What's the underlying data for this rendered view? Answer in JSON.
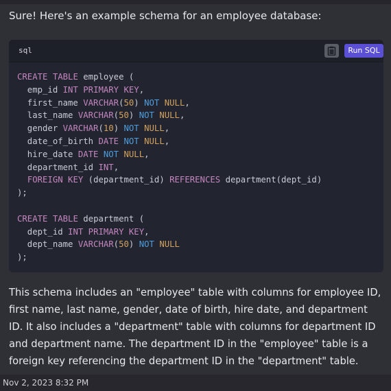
{
  "message": {
    "intro": "Sure! Here's an example schema for an employee database:",
    "explanation": "This schema includes an \"employee\" table with columns for employee ID, first name, last name, gender, date of birth, hire date, and department ID. It also includes a \"department\" table with columns for department ID and department name. The department ID in the \"employee\" table is a foreign key referencing the department ID in the \"department\" table.",
    "timestamp": "Nov 2, 2023 8:32 PM"
  },
  "code_block": {
    "language": "sql",
    "copy_icon": "clipboard-icon",
    "run_label": "Run SQL",
    "lines": [
      "CREATE TABLE employee (",
      "  emp_id INT PRIMARY KEY,",
      "  first_name VARCHAR(50) NOT NULL,",
      "  last_name VARCHAR(50) NOT NULL,",
      "  gender VARCHAR(10) NOT NULL,",
      "  date_of_birth DATE NOT NULL,",
      "  hire_date DATE NOT NULL,",
      "  department_id INT,",
      "  FOREIGN KEY (department_id) REFERENCES department(dept_id)",
      ");",
      "",
      "CREATE TABLE department (",
      "  dept_id INT PRIMARY KEY,",
      "  dept_name VARCHAR(50) NOT NULL",
      ");"
    ]
  },
  "colors": {
    "accent": "#5b4fd6",
    "keyword": "#c586c0",
    "not_null": "#4f9dde",
    "number": "#d3a15e"
  }
}
